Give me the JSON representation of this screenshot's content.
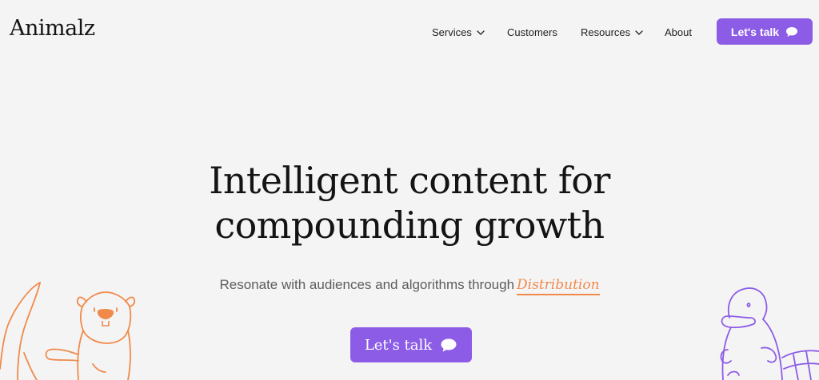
{
  "header": {
    "logo_text": "Animalz",
    "nav": [
      {
        "label": "Services",
        "has_dropdown": true,
        "icon": "chevron-down-icon"
      },
      {
        "label": "Customers",
        "has_dropdown": false
      },
      {
        "label": "Resources",
        "has_dropdown": true,
        "icon": "chevron-down-icon"
      },
      {
        "label": "About",
        "has_dropdown": false
      }
    ],
    "cta_label": "Let's talk",
    "cta_icon": "chat-bubble-icon"
  },
  "hero": {
    "title_line1": "Intelligent content for",
    "title_line2": "compounding growth",
    "subtitle": "Resonate with audiences and algorithms through",
    "highlight_word": "Distribution",
    "cta_label": "Let's talk",
    "cta_icon": "chat-bubble-icon"
  },
  "illustrations": {
    "left": "beaver-illustration",
    "right": "platypus-illustration"
  },
  "colors": {
    "background": "#f5f4f4",
    "accent_purple": "#8c5ce7",
    "accent_orange": "#f08a4b",
    "text_dark": "#141414",
    "text_muted": "#5d5d5d"
  }
}
